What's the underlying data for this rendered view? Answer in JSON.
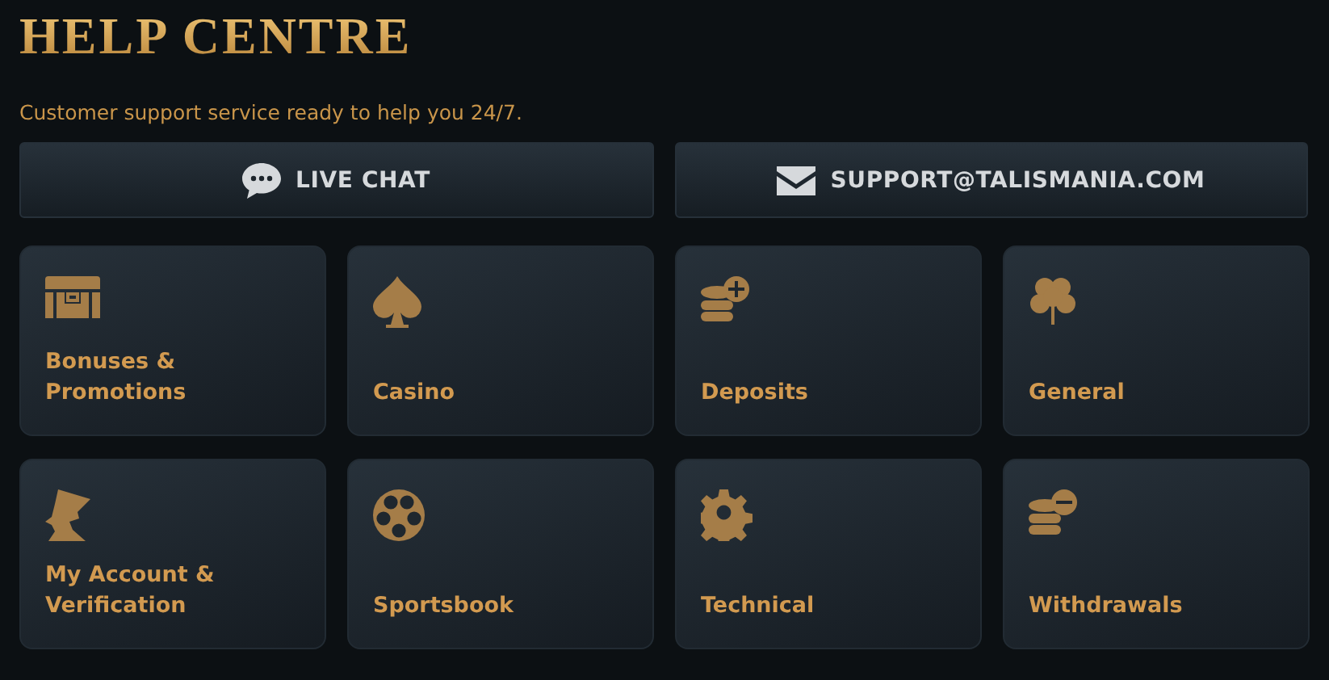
{
  "title": "HELP CENTRE",
  "subtitle": "Customer support service ready to help you 24/7.",
  "contacts": [
    {
      "label": "LIVE CHAT"
    },
    {
      "label": "SUPPORT@TALISMANIA.COM"
    }
  ],
  "categories": [
    {
      "label": "Bonuses & Promotions"
    },
    {
      "label": "Casino"
    },
    {
      "label": "Deposits"
    },
    {
      "label": "General"
    },
    {
      "label": "My Account & Verification"
    },
    {
      "label": "Sportsbook"
    },
    {
      "label": "Technical"
    },
    {
      "label": "Withdrawals"
    }
  ]
}
